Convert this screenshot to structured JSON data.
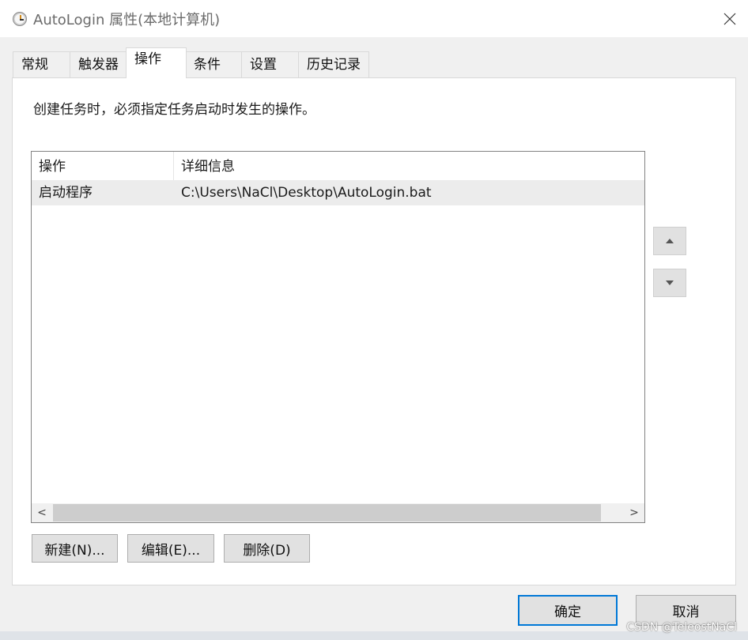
{
  "window": {
    "title": "AutoLogin 属性(本地计算机)",
    "icon": "task-scheduler-clock-icon",
    "close_glyph": "✕"
  },
  "tabs": [
    {
      "label": "常规",
      "active": false
    },
    {
      "label": "触发器",
      "active": false
    },
    {
      "label": "操作",
      "active": true
    },
    {
      "label": "条件",
      "active": false
    },
    {
      "label": "设置",
      "active": false
    },
    {
      "label": "历史记录",
      "active": false
    }
  ],
  "panel": {
    "instruction": "创建任务时，必须指定任务启动时发生的操作。"
  },
  "list": {
    "columns": [
      "操作",
      "详细信息"
    ],
    "rows": [
      {
        "action": "启动程序",
        "details": "C:\\Users\\NaCl\\Desktop\\AutoLogin.bat"
      }
    ],
    "scroll_left": "<",
    "scroll_right": ">"
  },
  "side_buttons": {
    "up_icon": "triangle-up-icon",
    "down_icon": "triangle-down-icon"
  },
  "action_buttons": {
    "new": "新建(N)...",
    "edit": "编辑(E)...",
    "delete": "删除(D)"
  },
  "dialog_buttons": {
    "ok": "确定",
    "cancel": "取消"
  },
  "watermark": "CSDN @TeleostNaCl",
  "colors": {
    "accent": "#0078d7",
    "selected_row": "#ececec",
    "window_bg": "#f0f0f0"
  }
}
